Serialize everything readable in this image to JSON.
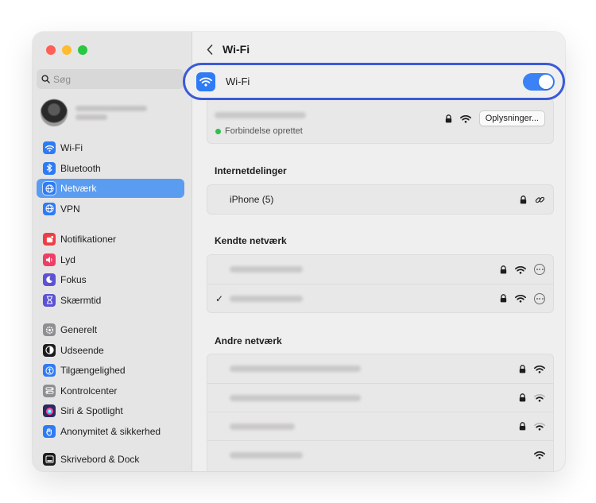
{
  "window": {
    "title": "Wi-Fi"
  },
  "colors": {
    "accent": "#3b82f6",
    "selection": "#5a9cf0",
    "highlight_ring": "#3a5bd8",
    "connected": "#2fbf4a"
  },
  "sidebar": {
    "traffic_lights": [
      "#fe5f57",
      "#febc2e",
      "#28c840"
    ],
    "search_placeholder": "Søg",
    "profile": {
      "avatar": "user-avatar"
    },
    "groups": [
      [
        {
          "label": "Wi-Fi",
          "icon": "wifi-icon",
          "color": "#2f7bf6"
        },
        {
          "label": "Bluetooth",
          "icon": "bluetooth-icon",
          "color": "#2f7bf6"
        },
        {
          "label": "Netværk",
          "icon": "globe-icon",
          "color": "#2f7bf6",
          "selected": true
        },
        {
          "label": "VPN",
          "icon": "vpn-icon",
          "color": "#2f7bf6"
        }
      ],
      [
        {
          "label": "Notifikationer",
          "icon": "bell-icon",
          "color": "#ee3e45"
        },
        {
          "label": "Lyd",
          "icon": "speaker-icon",
          "color": "#ee3e66"
        },
        {
          "label": "Fokus",
          "icon": "moon-icon",
          "color": "#5b52d6"
        },
        {
          "label": "Skærmtid",
          "icon": "hourglass-icon",
          "color": "#5b52d6"
        }
      ],
      [
        {
          "label": "Generelt",
          "icon": "gear-icon",
          "color": "#8e8e93"
        },
        {
          "label": "Udseende",
          "icon": "appearance-icon",
          "color": "#1d1d1f"
        },
        {
          "label": "Tilgængelighed",
          "icon": "accessibility-icon",
          "color": "#2f7bf6"
        },
        {
          "label": "Kontrolcenter",
          "icon": "control-center-icon",
          "color": "#8e8e93"
        },
        {
          "label": "Siri & Spotlight",
          "icon": "siri-icon",
          "color": "#2a2a60"
        },
        {
          "label": "Anonymitet & sikkerhed",
          "icon": "hand-icon",
          "color": "#2f7bf6"
        }
      ],
      [
        {
          "label": "Skrivebord & Dock",
          "icon": "dock-icon",
          "color": "#1d1d1f"
        }
      ]
    ]
  },
  "main": {
    "title": "Wi-Fi",
    "wifi_toggle": {
      "label": "Wi-Fi",
      "on": true
    },
    "current_network": {
      "status": "Forbindelse oprettet",
      "details_button": "Oplysninger..."
    },
    "hotspots": {
      "title": "Internetdelinger",
      "items": [
        {
          "name": "iPhone (5)"
        }
      ]
    },
    "known": {
      "title": "Kendte netværk",
      "items": [
        {
          "selected": false
        },
        {
          "selected": true,
          "check": "✓"
        }
      ]
    },
    "other": {
      "title": "Andre netværk",
      "items": [
        {
          "locked": true
        },
        {
          "locked": true
        },
        {
          "locked": true
        },
        {
          "locked": false
        }
      ]
    }
  }
}
